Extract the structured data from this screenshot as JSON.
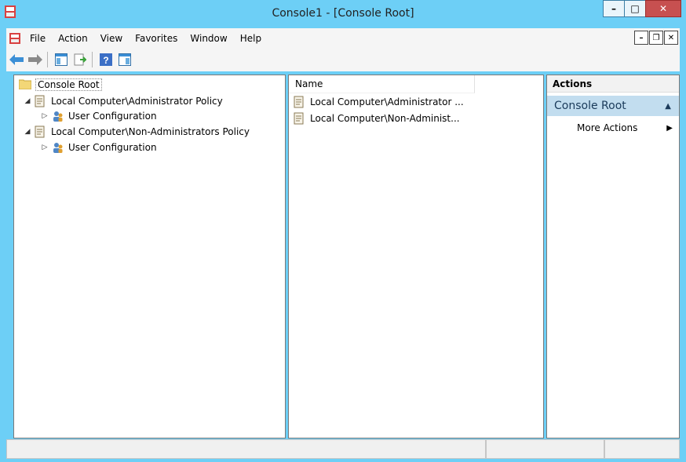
{
  "window": {
    "title": "Console1 - [Console Root]",
    "minimize": "–",
    "maximize": "□",
    "close": "✕"
  },
  "menu": {
    "items": [
      "File",
      "Action",
      "View",
      "Favorites",
      "Window",
      "Help"
    ],
    "mdi_minimize": "–",
    "mdi_restore": "❐",
    "mdi_close": "✕"
  },
  "tree": {
    "root": "Console Root",
    "nodes": [
      {
        "label": "Local Computer\\Administrator Policy",
        "expander": "◢",
        "child": "User Configuration",
        "child_expander": "▷"
      },
      {
        "label": "Local Computer\\Non-Administrators Policy",
        "expander": "◢",
        "child": "User Configuration",
        "child_expander": "▷"
      }
    ]
  },
  "list": {
    "column_name": "Name",
    "rows": [
      "Local Computer\\Administrator ...",
      "Local Computer\\Non-Administ..."
    ]
  },
  "actions": {
    "header": "Actions",
    "section": "Console Root",
    "section_arrow": "▲",
    "more_actions": "More Actions",
    "more_arrow": "▶"
  },
  "colors": {
    "titlebar": "#6dcff6",
    "close_button": "#c75050",
    "action_section": "#c2ddef"
  }
}
